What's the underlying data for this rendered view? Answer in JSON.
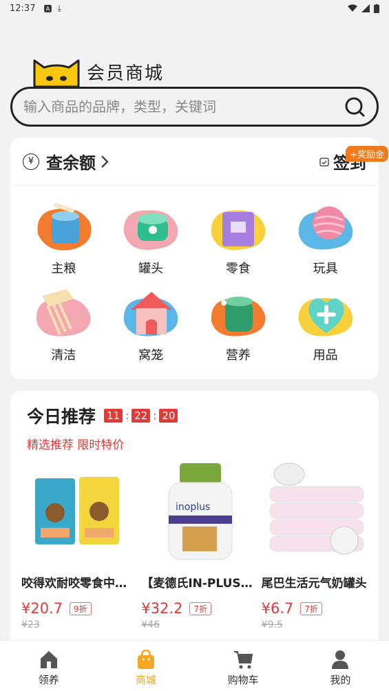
{
  "status_bar": {
    "time": "12:37"
  },
  "header": {
    "title": "会员商城"
  },
  "search": {
    "placeholder": "输入商品的品牌，类型，关键词"
  },
  "balance": {
    "currency_symbol": "¥",
    "label": "查余额",
    "signin_label": "签到",
    "bonus_badge": "+奖励金"
  },
  "categories": [
    {
      "label": "主粮",
      "icon": "bowl-icon"
    },
    {
      "label": "罐头",
      "icon": "can-icon"
    },
    {
      "label": "零食",
      "icon": "snack-bag-icon"
    },
    {
      "label": "玩具",
      "icon": "yarn-ball-icon"
    },
    {
      "label": "清洁",
      "icon": "comb-icon"
    },
    {
      "label": "窝笼",
      "icon": "pet-house-icon"
    },
    {
      "label": "营养",
      "icon": "supplement-jar-icon"
    },
    {
      "label": "用品",
      "icon": "heart-plus-icon"
    }
  ],
  "recommend": {
    "title": "今日推荐",
    "timer": {
      "h": "11",
      "m": "22",
      "s": "20"
    },
    "subtitle": "精选推荐 限时特价",
    "products": [
      {
        "name": "咬得欢耐咬零食中型犬",
        "price": "¥20.7",
        "discount": "9折",
        "original": "¥23"
      },
      {
        "name": "【麦德氏IN-PLUS】复合维生素片",
        "price": "¥32.2",
        "discount": "7折",
        "original": "¥46"
      },
      {
        "name": "尾巴生活元气奶罐头",
        "price": "¥6.7",
        "discount": "7折",
        "original": "¥9.5"
      }
    ]
  },
  "bottom_nav": [
    {
      "label": "领养",
      "icon": "home-icon",
      "active": false
    },
    {
      "label": "商城",
      "icon": "shopping-bag-icon",
      "active": true
    },
    {
      "label": "购物车",
      "icon": "cart-icon",
      "active": false
    },
    {
      "label": "我的",
      "icon": "user-icon",
      "active": false
    }
  ],
  "colors": {
    "accent": "#f5a623",
    "price_red": "#e53935",
    "badge_orange": "#f07b1e"
  }
}
